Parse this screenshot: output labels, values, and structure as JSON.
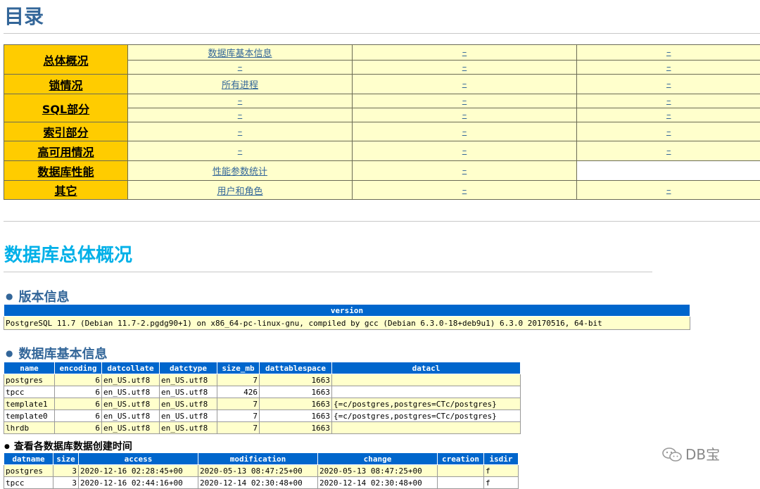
{
  "toc": {
    "title": "目录",
    "rows": [
      {
        "category": "总体概况",
        "cells": [
          [
            "数据库基本信息",
            "–",
            "–"
          ],
          [
            "–",
            "–",
            "–"
          ]
        ]
      },
      {
        "category": "锁情况",
        "cells": [
          [
            "所有进程",
            "–",
            "–"
          ]
        ]
      },
      {
        "category": "SQL部分",
        "cells": [
          [
            "–",
            "–",
            "–"
          ],
          [
            "–",
            "–",
            "–"
          ]
        ]
      },
      {
        "category": "索引部分",
        "cells": [
          [
            "–",
            "–",
            "–"
          ]
        ]
      },
      {
        "category": "高可用情况",
        "cells": [
          [
            "–",
            "–",
            "–"
          ]
        ]
      },
      {
        "category": "数据库性能",
        "cells": [
          [
            "性能参数统计",
            "–",
            ""
          ]
        ]
      },
      {
        "category": "其它",
        "cells": [
          [
            "用户和角色",
            "–",
            "–"
          ]
        ]
      }
    ]
  },
  "overview": {
    "title": "数据库总体概况"
  },
  "version_section": {
    "title": "版本信息",
    "header": "version",
    "value": "PostgreSQL 11.7 (Debian 11.7-2.pgdg90+1) on x86_64-pc-linux-gnu, compiled by gcc (Debian 6.3.0-18+deb9u1) 6.3.0 20170516, 64-bit"
  },
  "dbinfo_section": {
    "title": "数据库基本信息",
    "columns": [
      "name",
      "encoding",
      "datcollate",
      "datctype",
      "size_mb",
      "dattablespace",
      "datacl"
    ],
    "rows": [
      [
        "postgres",
        "6",
        "en_US.utf8",
        "en_US.utf8",
        "7",
        "1663",
        ""
      ],
      [
        "tpcc",
        "6",
        "en_US.utf8",
        "en_US.utf8",
        "426",
        "1663",
        ""
      ],
      [
        "template1",
        "6",
        "en_US.utf8",
        "en_US.utf8",
        "7",
        "1663",
        "{=c/postgres,postgres=CTc/postgres}"
      ],
      [
        "template0",
        "6",
        "en_US.utf8",
        "en_US.utf8",
        "7",
        "1663",
        "{=c/postgres,postgres=CTc/postgres}"
      ],
      [
        "lhrdb",
        "6",
        "en_US.utf8",
        "en_US.utf8",
        "7",
        "1663",
        ""
      ]
    ]
  },
  "ctime_section": {
    "title": "查看各数据库数据创建时间",
    "columns": [
      "datname",
      "size",
      "access",
      "modification",
      "change",
      "creation",
      "isdir"
    ],
    "rows": [
      [
        "postgres",
        "3",
        "2020-12-16 02:28:45+00",
        "2020-05-13 08:47:25+00",
        "2020-05-13 08:47:25+00",
        "",
        "f"
      ],
      [
        "tpcc",
        "3",
        "2020-12-16 02:44:16+00",
        "2020-12-14 02:30:48+00",
        "2020-12-14 02:30:48+00",
        "",
        "f"
      ]
    ]
  },
  "watermark": {
    "text": "DB宝"
  }
}
